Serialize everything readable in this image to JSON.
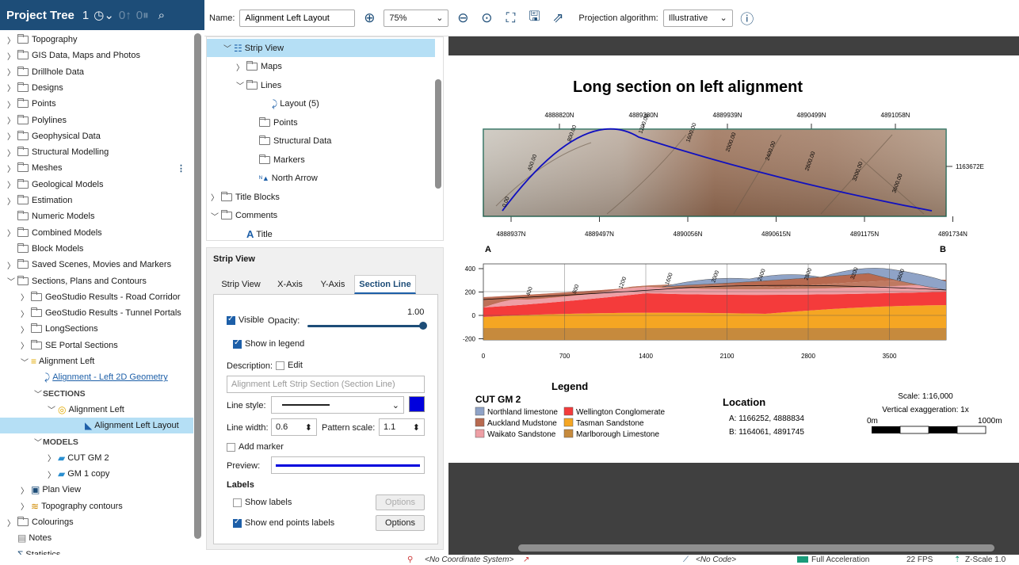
{
  "project_tree": {
    "title": "Project Tree",
    "badge": "1",
    "items": [
      {
        "label": "Topography",
        "indent": 0,
        "chev": ">",
        "kind": "folder"
      },
      {
        "label": "GIS Data, Maps and Photos",
        "indent": 0,
        "chev": ">",
        "kind": "folder"
      },
      {
        "label": "Drillhole Data",
        "indent": 0,
        "chev": ">",
        "kind": "folder"
      },
      {
        "label": "Designs",
        "indent": 0,
        "chev": ">",
        "kind": "folder"
      },
      {
        "label": "Points",
        "indent": 0,
        "chev": ">",
        "kind": "folder"
      },
      {
        "label": "Polylines",
        "indent": 0,
        "chev": ">",
        "kind": "folder"
      },
      {
        "label": "Geophysical Data",
        "indent": 0,
        "chev": ">",
        "kind": "folder"
      },
      {
        "label": "Structural Modelling",
        "indent": 0,
        "chev": ">",
        "kind": "folder"
      },
      {
        "label": "Meshes",
        "indent": 0,
        "chev": ">",
        "kind": "folder"
      },
      {
        "label": "Geological Models",
        "indent": 0,
        "chev": ">",
        "kind": "folder"
      },
      {
        "label": "Estimation",
        "indent": 0,
        "chev": ">",
        "kind": "folder"
      },
      {
        "label": "Numeric Models",
        "indent": 0,
        "chev": "",
        "kind": "folder"
      },
      {
        "label": "Combined Models",
        "indent": 0,
        "chev": ">",
        "kind": "folder"
      },
      {
        "label": "Block Models",
        "indent": 0,
        "chev": "",
        "kind": "folder"
      },
      {
        "label": "Saved Scenes, Movies and Markers",
        "indent": 0,
        "chev": ">",
        "kind": "folder"
      },
      {
        "label": "Sections, Plans and Contours",
        "indent": 0,
        "chev": "v",
        "kind": "folder"
      },
      {
        "label": "GeoStudio Results - Road Corridor",
        "indent": 1,
        "chev": ">",
        "kind": "folder"
      },
      {
        "label": "GeoStudio Results - Tunnel Portals",
        "indent": 1,
        "chev": ">",
        "kind": "folder"
      },
      {
        "label": "LongSections",
        "indent": 1,
        "chev": ">",
        "kind": "folder"
      },
      {
        "label": "SE Portal Sections",
        "indent": 1,
        "chev": ">",
        "kind": "folder"
      },
      {
        "label": "Alignment Left",
        "indent": 1,
        "chev": "v",
        "kind": "align"
      },
      {
        "label": "Alignment - Left 2D Geometry",
        "indent": 2,
        "chev": "",
        "kind": "geom"
      },
      {
        "label": "SECTIONS",
        "indent": 2,
        "chev": "v",
        "kind": "caps"
      },
      {
        "label": "Alignment Left",
        "indent": 3,
        "chev": "v",
        "kind": "section"
      },
      {
        "label": "Alignment Left Layout",
        "indent": 5,
        "chev": "",
        "kind": "layout"
      },
      {
        "label": "MODELS",
        "indent": 2,
        "chev": "v",
        "kind": "caps"
      },
      {
        "label": "CUT GM 2",
        "indent": 3,
        "chev": ">",
        "kind": "model"
      },
      {
        "label": "GM 1 copy",
        "indent": 3,
        "chev": ">",
        "kind": "model"
      },
      {
        "label": "Plan View",
        "indent": 1,
        "chev": ">",
        "kind": "plan"
      },
      {
        "label": "Topography contours",
        "indent": 1,
        "chev": ">",
        "kind": "contour"
      },
      {
        "label": "Colourings",
        "indent": 0,
        "chev": ">",
        "kind": "folder"
      },
      {
        "label": "Notes",
        "indent": 0,
        "chev": "",
        "kind": "note"
      },
      {
        "label": "Statistics",
        "indent": 0,
        "chev": "",
        "kind": "stats"
      }
    ]
  },
  "toolbar": {
    "name_label": "Name:",
    "name_value": "Alignment Left Layout",
    "zoom_value": "75%",
    "projection_label": "Projection algorithm:",
    "projection_value": "Illustrative"
  },
  "layout_tree": {
    "items": [
      {
        "label": "Strip View",
        "indent": 1,
        "chev": "v",
        "kind": "strip"
      },
      {
        "label": "Maps",
        "indent": 2,
        "chev": ">",
        "kind": "folder"
      },
      {
        "label": "Lines",
        "indent": 2,
        "chev": "v",
        "kind": "folder"
      },
      {
        "label": "Layout (5)",
        "indent": 4,
        "chev": "",
        "kind": "layoutline"
      },
      {
        "label": "Points",
        "indent": 3,
        "chev": "",
        "kind": "folder"
      },
      {
        "label": "Structural Data",
        "indent": 3,
        "chev": "",
        "kind": "folder"
      },
      {
        "label": "Markers",
        "indent": 3,
        "chev": "",
        "kind": "folder"
      },
      {
        "label": "North Arrow",
        "indent": 3,
        "chev": "",
        "kind": "north"
      },
      {
        "label": "Title Blocks",
        "indent": 0,
        "chev": ">",
        "kind": "folder"
      },
      {
        "label": "Comments",
        "indent": 0,
        "chev": "v",
        "kind": "folder"
      },
      {
        "label": "Title",
        "indent": 2,
        "chev": "",
        "kind": "titleA"
      }
    ]
  },
  "props": {
    "title": "Strip View",
    "tabs": [
      "Strip View",
      "X-Axis",
      "Y-Axis",
      "Section Line"
    ],
    "active_tab": "Section Line",
    "visible_label": "Visible",
    "opacity_label": "Opacity:",
    "opacity_value": "1.00",
    "opacity_level": 1.0,
    "show_legend_label": "Show in legend",
    "description_label": "Description:",
    "edit_label": "Edit",
    "description_placeholder": "Alignment Left Strip Section (Section Line)",
    "line_style_label": "Line style:",
    "line_width_label": "Line width:",
    "line_width_value": "0.6",
    "pattern_scale_label": "Pattern scale:",
    "pattern_scale_value": "1.1",
    "add_marker_label": "Add marker",
    "preview_label": "Preview:",
    "labels_heading": "Labels",
    "show_labels_label": "Show labels",
    "options_label": "Options",
    "show_end_labels_label": "Show end points labels",
    "line_color": "#0000dd"
  },
  "layout_sheet": {
    "title": "Long section on left alignment",
    "top_ticks": [
      "4888820N",
      "4889380N",
      "4889939N",
      "4890499N",
      "4891058N"
    ],
    "bottom_ticks": [
      "4888937N",
      "4889497N",
      "4890056N",
      "4890615N",
      "4891175N",
      "4891734N"
    ],
    "right_tick": "1163672E",
    "point_a": "A",
    "point_b": "B",
    "map_chainage": [
      "0.00",
      "400.00",
      "800.00",
      "1200.00",
      "1600.00",
      "2000.00",
      "2400.00",
      "2800.00",
      "3200.00",
      "3600.00"
    ],
    "section_y_ticks": [
      "400",
      "200",
      "0",
      "-200"
    ],
    "section_x_ticks": [
      "0",
      "700",
      "1400",
      "2100",
      "2800",
      "3500"
    ],
    "section_chainage": [
      "400",
      "800",
      "1200",
      "1600",
      "2000",
      "2400",
      "2800",
      "3200",
      "3600"
    ],
    "legend_heading": "Legend",
    "legend_model": "CUT GM 2",
    "legend_items": [
      {
        "label": "Northland limestone",
        "color": "#8fa3c7"
      },
      {
        "label": "Wellington Conglomerate",
        "color": "#f43b3b"
      },
      {
        "label": "Auckland Mudstone",
        "color": "#b86a50"
      },
      {
        "label": "Tasman Sandstone",
        "color": "#f5a623"
      },
      {
        "label": "Waikato Sandstone",
        "color": "#ee9fa5"
      },
      {
        "label": "Marlborough Limestone",
        "color": "#c68a3d"
      }
    ],
    "location_heading": "Location",
    "location_a": "A:  1166252, 4888834",
    "location_b": "B:  1164061, 4891745",
    "scale_text": "Scale: 1:16,000",
    "vert_exag": "Vertical exaggeration: 1x",
    "scale_start": "0m",
    "scale_end": "1000m"
  },
  "status": {
    "coord_system": "<No Coordinate System>",
    "code": "<No Code>",
    "acceleration": "Full Acceleration",
    "fps": "22 FPS",
    "zscale": "Z-Scale 1.0"
  }
}
